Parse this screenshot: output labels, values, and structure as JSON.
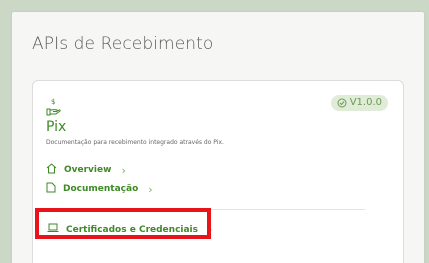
{
  "page": {
    "title": "APIs de Recebimento"
  },
  "card": {
    "icon": "hand-money-icon",
    "name": "Pix",
    "version": "V1.0.0",
    "version_icon": "check-circle-icon",
    "description": "Documentação para recebimento integrado através do Pix.",
    "links": [
      {
        "label": "Overview",
        "icon": "home-icon"
      },
      {
        "label": "Documentação",
        "icon": "document-icon"
      },
      {
        "label": "Certificados e Credenciais",
        "icon": "laptop-icon"
      }
    ]
  },
  "colors": {
    "brand_green": "#3e8a26",
    "badge_bg": "#e0ecd8",
    "highlight": "#e8131b",
    "background": "#cbd8c6"
  }
}
